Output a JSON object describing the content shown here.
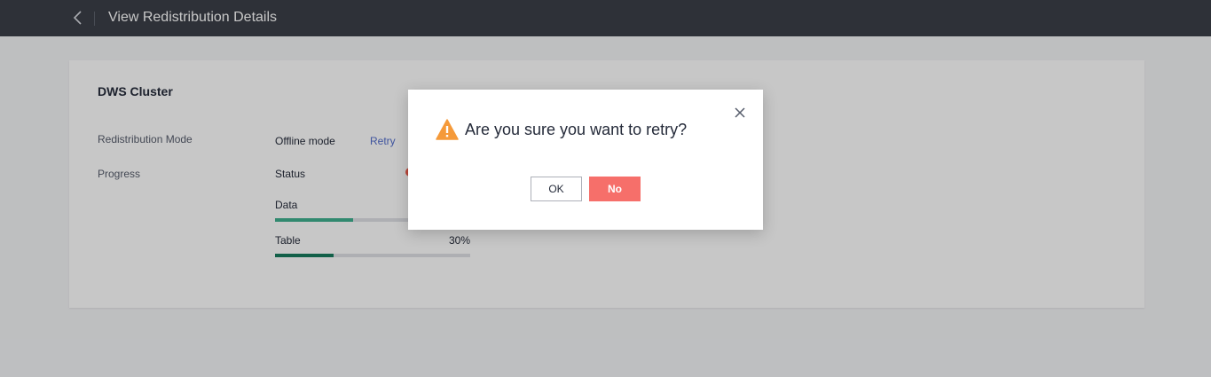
{
  "header": {
    "title": "View Redistribution Details",
    "back_icon": "chevron-left-icon"
  },
  "card": {
    "title": "DWS Cluster",
    "mode_label": "Redistribution Mode",
    "mode_value": "Offline mode",
    "retry_label": "Retry",
    "progress_label": "Progress",
    "status_label": "Status",
    "status_color": "#f05a4a",
    "data_label": "Data",
    "data_progress": 40,
    "data_color": "#3fb08f",
    "table_label": "Table",
    "table_percent": "30%",
    "table_progress": 30,
    "table_color": "#187b5e"
  },
  "dialog": {
    "message": "Are you sure you want to retry?",
    "ok_label": "OK",
    "no_label": "No",
    "warning_color": "#f59a3a",
    "no_color": "#f66f6a"
  }
}
